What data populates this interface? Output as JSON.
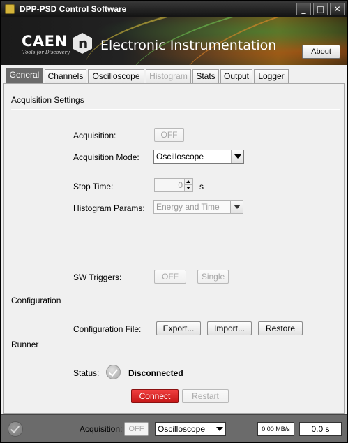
{
  "window": {
    "title": "DPP-PSD Control Software",
    "minimize_glyph": "_",
    "maximize_glyph": "□",
    "close_glyph": "✕"
  },
  "banner": {
    "brand": "CAEN",
    "tagline": "Tools for Discovery",
    "logo_letter": "n",
    "division": "Electronic Instrumentation",
    "about_label": "About"
  },
  "tabs": [
    {
      "label": "General",
      "active": true,
      "enabled": true
    },
    {
      "label": "Channels",
      "active": false,
      "enabled": true
    },
    {
      "label": "Oscilloscope",
      "active": false,
      "enabled": true
    },
    {
      "label": "Histogram",
      "active": false,
      "enabled": false
    },
    {
      "label": "Stats",
      "active": false,
      "enabled": true
    },
    {
      "label": "Output",
      "active": false,
      "enabled": true
    },
    {
      "label": "Logger",
      "active": false,
      "enabled": true
    }
  ],
  "acquisition_settings": {
    "title": "Acquisition Settings",
    "acquisition_label": "Acquisition:",
    "acquisition_value": "OFF",
    "mode_label": "Acquisition Mode:",
    "mode_value": "Oscilloscope",
    "stop_time_label": "Stop Time:",
    "stop_time_value": "0",
    "stop_time_unit": "s",
    "histogram_params_label": "Histogram Params:",
    "histogram_params_value": "Energy and Time",
    "sw_triggers_label": "SW Triggers:",
    "sw_triggers_value": "OFF",
    "single_label": "Single"
  },
  "configuration": {
    "title": "Configuration",
    "file_label": "Configuration File:",
    "export_label": "Export...",
    "import_label": "Import...",
    "restore_label": "Restore"
  },
  "runner": {
    "title": "Runner",
    "status_label": "Status:",
    "status_value": "Disconnected",
    "connect_label": "Connect",
    "restart_label": "Restart"
  },
  "statusbar": {
    "acquisition_label": "Acquisition:",
    "acquisition_value": "OFF",
    "mode_value": "Oscilloscope",
    "rate": "0.00 MB/s",
    "elapsed": "0.0 s"
  },
  "colors": {
    "active_tab": "#6b6b6b",
    "connect_button": "#d62020",
    "statusbar": "#6b6b6b"
  }
}
